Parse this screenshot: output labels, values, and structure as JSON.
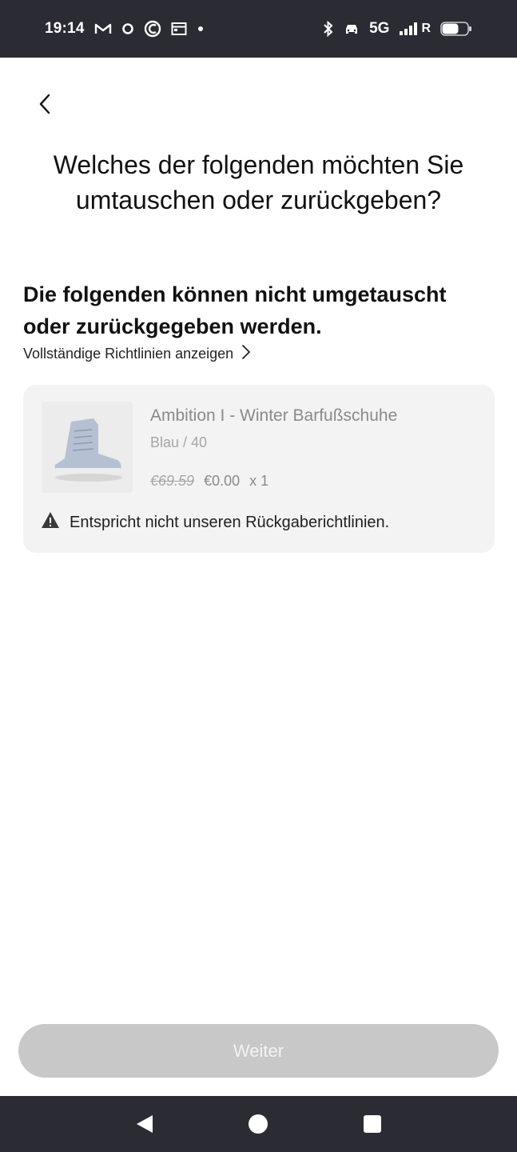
{
  "status_bar": {
    "time": "19:14",
    "network": "5G",
    "roaming": "R",
    "icons_left": [
      "gmail-icon",
      "circle-icon",
      "app-icon",
      "calendar-icon",
      "dot-icon"
    ],
    "icons_right": [
      "bluetooth-icon",
      "car-icon",
      "signal-icon",
      "battery-icon"
    ]
  },
  "header": {
    "back_icon": "chevron-left-icon",
    "title": "Welches der folgenden möchten Sie umtauschen oder zurückgeben?"
  },
  "section": {
    "heading": "Die folgenden können nicht umgetauscht oder zurückgegeben werden.",
    "policy_link": "Vollständige Richtlinien anzeigen"
  },
  "item": {
    "name": "Ambition I - Winter Barfußschuhe",
    "variant": "Blau / 40",
    "price_original": "€69.59",
    "price_current": "€0.00",
    "quantity": "x 1",
    "notice": "Entspricht nicht unseren Rückgaberichtlinien.",
    "thumb_color": "#b9c4d3"
  },
  "footer": {
    "continue_label": "Weiter",
    "button_color": "#c8c8c8"
  },
  "nav": {
    "icons": [
      "back-triangle-icon",
      "home-circle-icon",
      "recents-square-icon"
    ]
  }
}
